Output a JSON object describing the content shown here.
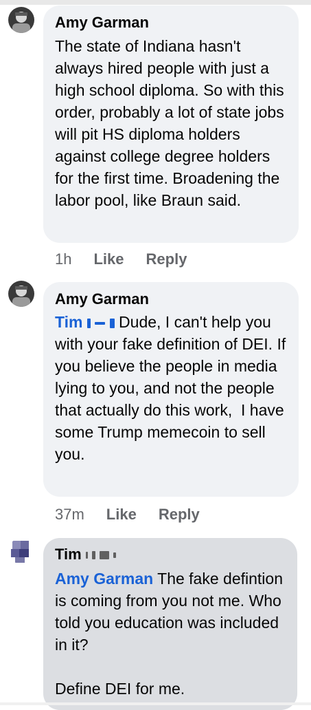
{
  "comments": [
    {
      "author": "Amy Garman",
      "text": "The state of Indiana hasn't always hired people with just a high school diploma. So with this order, probably a lot of state jobs will pit HS diploma holders against college degree holders for the first time. Broadening the labor pool, like Braun said.",
      "time": "1h",
      "like_label": "Like",
      "reply_label": "Reply"
    },
    {
      "author": "Amy Garman",
      "mention": "Tim",
      "text": " Dude, I can't help you with your fake definition of DEI. If you believe the people in media lying to you, and not the people that actually do this work,  I have some Trump memecoin to sell you.",
      "time": "37m",
      "like_label": "Like",
      "reply_label": "Reply"
    },
    {
      "author": "Tim",
      "mention": "Amy Garman",
      "text": " The fake defintion is coming from you not me. Who told you education was included in it?\n\nDefine DEI for me."
    }
  ],
  "colors": {
    "mention": "#1a62d6",
    "meta_grey": "#65676b",
    "bubble_light": "#f0f2f5",
    "bubble_highlight": "#dcdee2"
  }
}
